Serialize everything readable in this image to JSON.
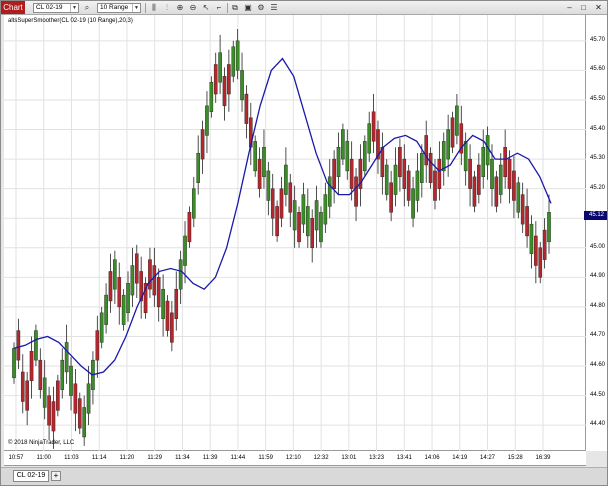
{
  "toolbar": {
    "chart_tab": "Chart",
    "instrument": "CL 02-19",
    "interval": "10 Range"
  },
  "indicator_label": "altsSuperSmoother(CL 02-19 (10 Range),20,3)",
  "copyright": "© 2018 NinjaTrader, LLC",
  "price_marker": "45.12",
  "bottom_tab": "CL 02-19",
  "add_tab": "+",
  "colors": {
    "up": "#3c8c28",
    "down": "#b3272d",
    "line": "#1a1aaa",
    "grid": "#e2e2e2",
    "marker": "#0a0a6e"
  },
  "chart_data": {
    "type": "candlestick",
    "y_ticks": [
      "45.70",
      "45.60",
      "45.50",
      "45.40",
      "45.30",
      "45.20",
      "45.10",
      "45.00",
      "44.90",
      "44.80",
      "44.70",
      "44.60",
      "44.50",
      "44.40"
    ],
    "ylim": [
      44.36,
      45.74
    ],
    "x_ticks": [
      "10:57",
      "11:00",
      "11:03",
      "11:14",
      "11:20",
      "11:29",
      "11:34",
      "11:39",
      "11:44",
      "11:59",
      "12:10",
      "12:32",
      "13:01",
      "13:23",
      "13:41",
      "14:06",
      "14:19",
      "14:27",
      "15:28",
      "16:39"
    ],
    "closes": [
      44.66,
      44.72,
      44.58,
      44.55,
      44.65,
      44.72,
      44.62,
      44.56,
      44.5,
      44.48,
      44.55,
      44.62,
      44.68,
      44.6,
      44.54,
      44.49,
      44.46,
      44.54,
      44.62,
      44.72,
      44.78,
      44.84,
      44.92,
      44.96,
      44.9,
      44.84,
      44.88,
      44.94,
      44.98,
      44.92,
      44.88,
      44.96,
      44.94,
      44.9,
      44.86,
      44.82,
      44.78,
      44.86,
      44.96,
      45.04,
      45.12,
      45.2,
      45.32,
      45.4,
      45.48,
      45.56,
      45.62,
      45.66,
      45.58,
      45.62,
      45.68,
      45.7,
      45.6,
      45.52,
      45.44,
      45.36,
      45.3,
      45.34,
      45.26,
      45.2,
      45.14,
      45.2,
      45.28,
      45.22,
      45.16,
      45.12,
      45.18,
      45.14,
      45.1,
      45.16,
      45.12,
      45.18,
      45.24,
      45.3,
      45.34,
      45.4,
      45.36,
      45.3,
      45.24,
      45.3,
      45.36,
      45.42,
      45.46,
      45.4,
      45.34,
      45.28,
      45.22,
      45.28,
      45.34,
      45.3,
      45.26,
      45.2,
      45.26,
      45.32,
      45.38,
      45.32,
      45.26,
      45.3,
      45.36,
      45.4,
      45.44,
      45.48,
      45.42,
      45.36,
      45.3,
      45.24,
      45.28,
      45.34,
      45.38,
      45.3,
      45.24,
      45.28,
      45.34,
      45.3,
      45.26,
      45.22,
      45.18,
      45.14,
      45.08,
      45.04,
      45.0,
      45.06,
      45.12
    ],
    "smoother": [
      44.66,
      44.67,
      44.69,
      44.7,
      44.68,
      44.64,
      44.6,
      44.57,
      44.58,
      44.62,
      44.7,
      44.8,
      44.88,
      44.92,
      44.93,
      44.92,
      44.88,
      44.86,
      44.9,
      45.0,
      45.15,
      45.32,
      45.48,
      45.6,
      45.64,
      45.58,
      45.45,
      45.32,
      45.22,
      45.18,
      45.18,
      45.22,
      45.28,
      45.34,
      45.37,
      45.38,
      45.36,
      45.3,
      45.26,
      45.28,
      45.34,
      45.38,
      45.36,
      45.3,
      45.3,
      45.32,
      45.3,
      45.24,
      45.15
    ]
  }
}
